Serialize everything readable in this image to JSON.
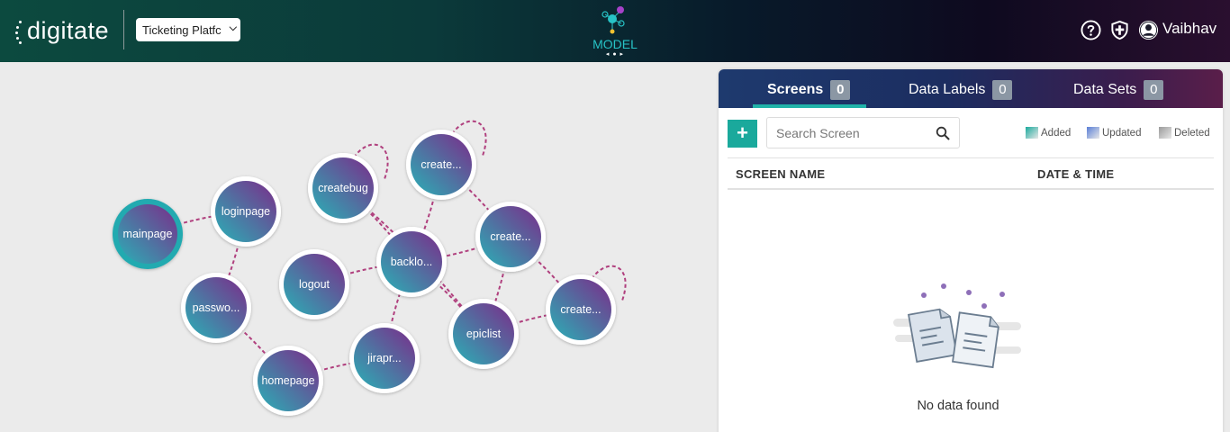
{
  "header": {
    "logo_text": "digitate",
    "project_select_value": "Ticketing Platfc",
    "model_label": "MODEL",
    "model_arrows": "◂ ● ▸",
    "user_name": "Vaibhav",
    "icons": [
      "help-icon",
      "shield-icon",
      "user-avatar-icon"
    ]
  },
  "graph": {
    "nodes": [
      {
        "id": "mainpage",
        "label": "mainpage",
        "selected": true
      },
      {
        "id": "loginpage",
        "label": "loginpage"
      },
      {
        "id": "createbug",
        "label": "createbug"
      },
      {
        "id": "create1",
        "label": "create..."
      },
      {
        "id": "create2",
        "label": "create..."
      },
      {
        "id": "backlog",
        "label": "backlo..."
      },
      {
        "id": "logout",
        "label": "logout"
      },
      {
        "id": "password",
        "label": "passwo..."
      },
      {
        "id": "create3",
        "label": "create..."
      },
      {
        "id": "epiclist",
        "label": "epiclist"
      },
      {
        "id": "jira",
        "label": "jirapr..."
      },
      {
        "id": "homepage",
        "label": "homepage"
      }
    ]
  },
  "panel": {
    "tabs": [
      {
        "label": "Screens",
        "count": "0",
        "active": true
      },
      {
        "label": "Data Labels",
        "count": "0",
        "active": false
      },
      {
        "label": "Data Sets",
        "count": "0",
        "active": false
      }
    ],
    "add_label": "+",
    "search_placeholder": "Search Screen",
    "legend": [
      {
        "label": "Added",
        "color": "#1aa99c"
      },
      {
        "label": "Updated",
        "color": "#5a7fd6"
      },
      {
        "label": "Deleted",
        "color": "#9a9a9a"
      }
    ],
    "columns": [
      "SCREEN NAME",
      "DATE & TIME"
    ],
    "empty_text": "No data found"
  },
  "colors": {
    "accent": "#1aa99c",
    "edge": "#b0407e",
    "node_gradient_start": "#2ab0b6",
    "node_gradient_end": "#7b2c8a"
  }
}
